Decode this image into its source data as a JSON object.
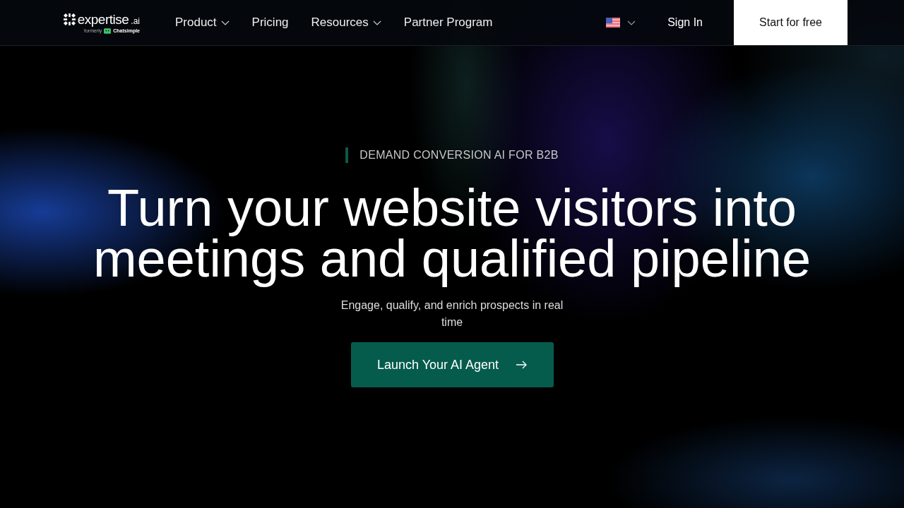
{
  "logo": {
    "name": "expertise",
    "suffix": ".ai",
    "formerly": "formerly",
    "former_name": "Chatsimple"
  },
  "nav": [
    {
      "label": "Product",
      "kind": "dropdown"
    },
    {
      "label": "Pricing",
      "kind": "link"
    },
    {
      "label": "Resources",
      "kind": "dropdown"
    },
    {
      "label": "Partner Program",
      "kind": "link"
    }
  ],
  "sign_in": "Sign In",
  "start_button": "Start for free",
  "hero": {
    "eyebrow": "DEMAND CONVERSION AI FOR B2B",
    "headline": "Turn your website visitors into meetings and qualified pipeline",
    "subtitle": "Engage, qualify, and enrich prospects in real time",
    "cta": "Launch Your AI Agent"
  }
}
